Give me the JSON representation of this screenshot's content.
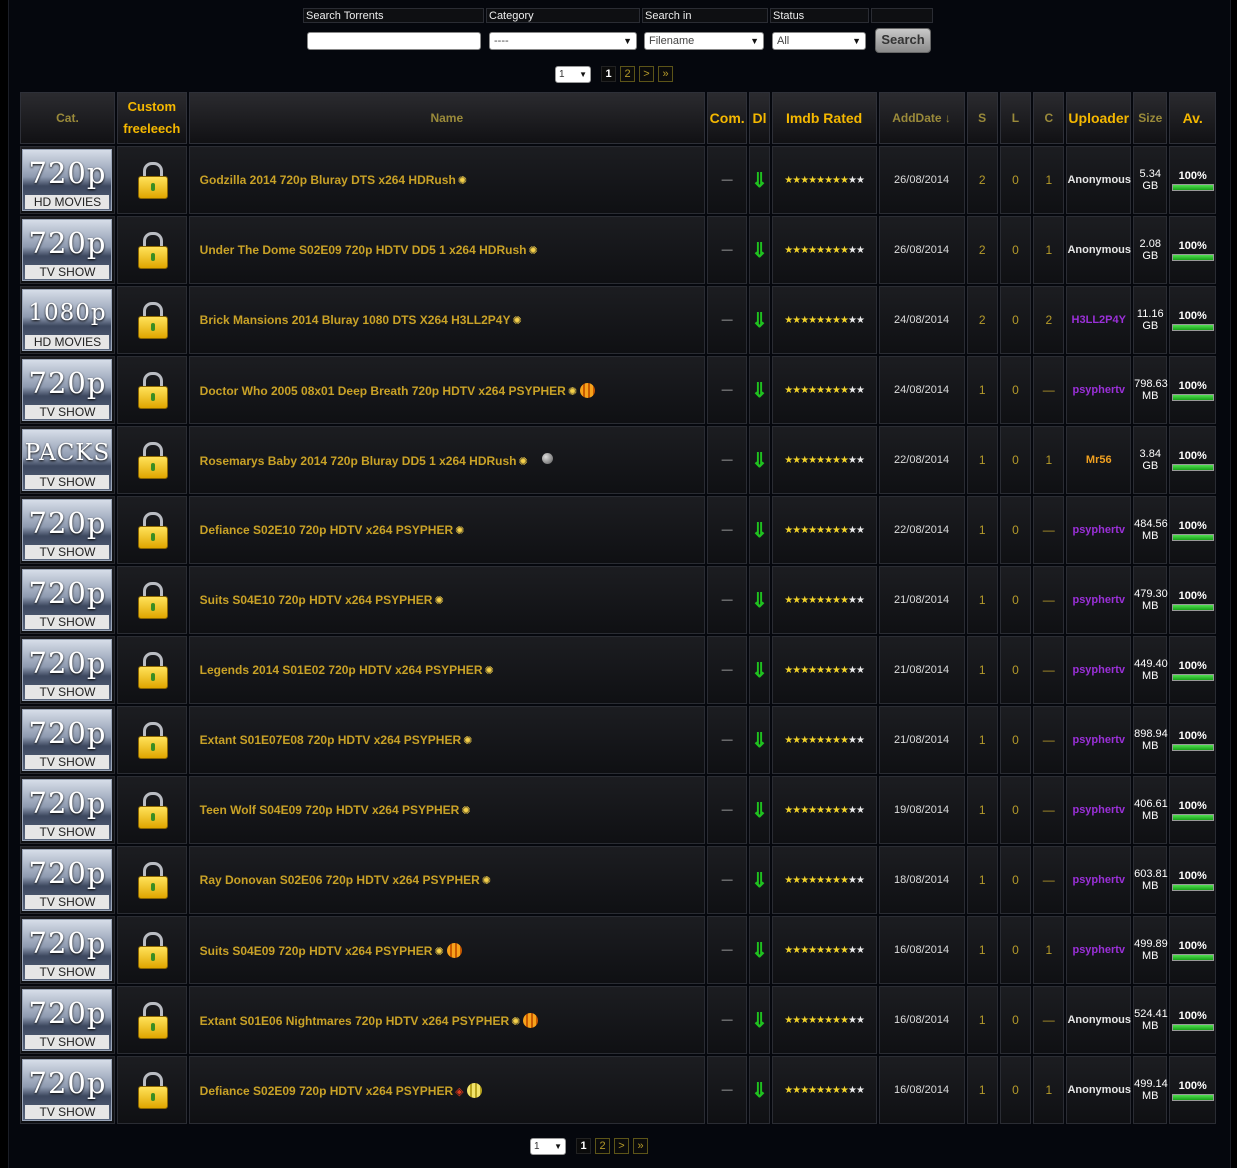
{
  "search": {
    "label_search": "Search Torrents",
    "label_category": "Category",
    "label_search_in": "Search in",
    "label_status": "Status",
    "search_value": "",
    "category_value": "----",
    "search_in_value": "Filename",
    "status_value": "All",
    "button": "Search"
  },
  "pagination": {
    "select_value": "1",
    "pages": [
      "1",
      "2"
    ],
    "next": ">",
    "last": "»"
  },
  "columns": {
    "cat": "Cat.",
    "custom": "Custom freeleech",
    "name": "Name",
    "com": "Com.",
    "dl": "Dl",
    "imdb": "Imdb Rated",
    "adddate": "AddDate ↓",
    "s": "S",
    "l": "L",
    "c": "C",
    "uploader": "Uploader",
    "size": "Size",
    "av": "Av."
  },
  "colors": {
    "accent": "#f5b800",
    "link": "#c9a227",
    "purple": "#9b30d9",
    "orange_user": "#f0a020",
    "green": "#1fc21f"
  },
  "rows": [
    {
      "cat_main": "720p",
      "cat_sub": "HD MOVIES",
      "name": "Godzilla 2014 720p Bluray DTS x264 HDRush",
      "badges": [
        "sun"
      ],
      "com": "—",
      "date": "26/08/2014",
      "s": "2",
      "l": "0",
      "c": "1",
      "uploader": "Anonymous",
      "ucls": "white",
      "size1": "5.34",
      "size2": "GB",
      "av": "100%"
    },
    {
      "cat_main": "720p",
      "cat_sub": "TV SHOW",
      "name": "Under The Dome S02E09 720p HDTV DD5 1 x264 HDRush",
      "badges": [
        "sun"
      ],
      "com": "—",
      "date": "26/08/2014",
      "s": "2",
      "l": "0",
      "c": "1",
      "uploader": "Anonymous",
      "ucls": "white",
      "size1": "2.08",
      "size2": "GB",
      "av": "100%"
    },
    {
      "cat_main": "1080p",
      "cat_sub": "HD MOVIES",
      "name": "Brick Mansions 2014 Bluray 1080 DTS X264 H3LL2P4Y",
      "badges": [
        "sun"
      ],
      "com": "—",
      "date": "24/08/2014",
      "s": "2",
      "l": "0",
      "c": "2",
      "uploader": "H3LL2P4Y",
      "ucls": "purple",
      "size1": "11.16",
      "size2": "GB",
      "av": "100%"
    },
    {
      "cat_main": "720p",
      "cat_sub": "TV SHOW",
      "name": "Doctor Who 2005 08x01 Deep Breath 720p HDTV x264 PSYPHER",
      "badges": [
        "sun",
        "orange"
      ],
      "com": "—",
      "date": "24/08/2014",
      "s": "1",
      "l": "0",
      "c": "—",
      "uploader": "psyphertv",
      "ucls": "purple",
      "size1": "798.63",
      "size2": "MB",
      "av": "100%"
    },
    {
      "cat_main": "PACKS",
      "cat_sub": "TV SHOW",
      "name": "Rosemarys Baby 2014 720p Bluray DD5 1 x264 HDRush",
      "badges": [
        "sun",
        "gray"
      ],
      "com": "—",
      "date": "22/08/2014",
      "s": "1",
      "l": "0",
      "c": "1",
      "uploader": "Mr56",
      "ucls": "orange",
      "size1": "3.84",
      "size2": "GB",
      "av": "100%"
    },
    {
      "cat_main": "720p",
      "cat_sub": "TV SHOW",
      "name": "Defiance S02E10 720p HDTV x264 PSYPHER",
      "badges": [
        "sun"
      ],
      "com": "—",
      "date": "22/08/2014",
      "s": "1",
      "l": "0",
      "c": "—",
      "uploader": "psyphertv",
      "ucls": "purple",
      "size1": "484.56",
      "size2": "MB",
      "av": "100%"
    },
    {
      "cat_main": "720p",
      "cat_sub": "TV SHOW",
      "name": "Suits S04E10 720p HDTV x264 PSYPHER",
      "badges": [
        "sun"
      ],
      "com": "—",
      "date": "21/08/2014",
      "s": "1",
      "l": "0",
      "c": "—",
      "uploader": "psyphertv",
      "ucls": "purple",
      "size1": "479.30",
      "size2": "MB",
      "av": "100%"
    },
    {
      "cat_main": "720p",
      "cat_sub": "TV SHOW",
      "name": "Legends 2014 S01E02 720p HDTV x264 PSYPHER",
      "badges": [
        "sun"
      ],
      "com": "—",
      "date": "21/08/2014",
      "s": "1",
      "l": "0",
      "c": "—",
      "uploader": "psyphertv",
      "ucls": "purple",
      "size1": "449.40",
      "size2": "MB",
      "av": "100%"
    },
    {
      "cat_main": "720p",
      "cat_sub": "TV SHOW",
      "name": "Extant S01E07E08 720p HDTV x264 PSYPHER",
      "badges": [
        "sun"
      ],
      "com": "—",
      "date": "21/08/2014",
      "s": "1",
      "l": "0",
      "c": "—",
      "uploader": "psyphertv",
      "ucls": "purple",
      "size1": "898.94",
      "size2": "MB",
      "av": "100%"
    },
    {
      "cat_main": "720p",
      "cat_sub": "TV SHOW",
      "name": "Teen Wolf S04E09 720p HDTV x264 PSYPHER",
      "badges": [
        "sun"
      ],
      "com": "—",
      "date": "19/08/2014",
      "s": "1",
      "l": "0",
      "c": "—",
      "uploader": "psyphertv",
      "ucls": "purple",
      "size1": "406.61",
      "size2": "MB",
      "av": "100%"
    },
    {
      "cat_main": "720p",
      "cat_sub": "TV SHOW",
      "name": "Ray Donovan S02E06 720p HDTV x264 PSYPHER",
      "badges": [
        "sun"
      ],
      "com": "—",
      "date": "18/08/2014",
      "s": "1",
      "l": "0",
      "c": "—",
      "uploader": "psyphertv",
      "ucls": "purple",
      "size1": "603.81",
      "size2": "MB",
      "av": "100%"
    },
    {
      "cat_main": "720p",
      "cat_sub": "TV SHOW",
      "name": "Suits S04E09 720p HDTV x264 PSYPHER",
      "badges": [
        "sun",
        "orange"
      ],
      "com": "—",
      "date": "16/08/2014",
      "s": "1",
      "l": "0",
      "c": "1",
      "uploader": "psyphertv",
      "ucls": "purple",
      "size1": "499.89",
      "size2": "MB",
      "av": "100%"
    },
    {
      "cat_main": "720p",
      "cat_sub": "TV SHOW",
      "name": "Extant S01E06 Nightmares 720p HDTV x264 PSYPHER",
      "badges": [
        "sun",
        "orange"
      ],
      "com": "—",
      "date": "16/08/2014",
      "s": "1",
      "l": "0",
      "c": "—",
      "uploader": "Anonymous",
      "ucls": "white",
      "size1": "524.41",
      "size2": "MB",
      "av": "100%"
    },
    {
      "cat_main": "720p",
      "cat_sub": "TV SHOW",
      "name": "Defiance S02E09 720p HDTV x264 PSYPHER",
      "badges": [
        "red",
        "yellow"
      ],
      "com": "—",
      "date": "16/08/2014",
      "s": "1",
      "l": "0",
      "c": "1",
      "uploader": "Anonymous",
      "ucls": "white",
      "size1": "499.14",
      "size2": "MB",
      "av": "100%"
    }
  ],
  "stars": {
    "on": 8,
    "total": 10
  }
}
